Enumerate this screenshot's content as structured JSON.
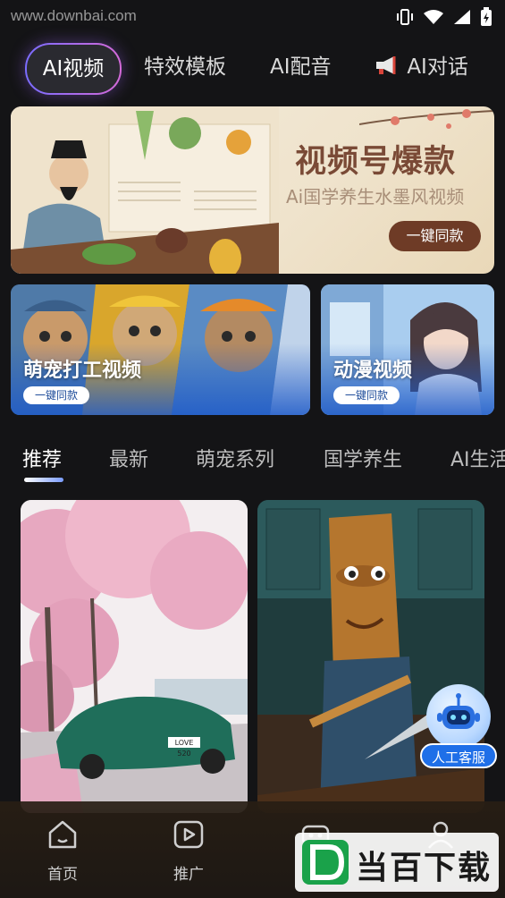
{
  "status_bar": {
    "watermark": "www.downbai.com"
  },
  "top_tabs": [
    {
      "label": "AI视频",
      "active": true
    },
    {
      "label": "特效模板",
      "active": false
    },
    {
      "label": "AI配音",
      "active": false
    },
    {
      "label": "AI对话",
      "active": false
    }
  ],
  "banner": {
    "title": "视频号爆款",
    "subtitle": "Ai国学养生水墨风视频",
    "button": "一键同款"
  },
  "cards": [
    {
      "label": "萌宠打工视频",
      "button": "一键同款"
    },
    {
      "label": "动漫视频",
      "button": "一键同款"
    }
  ],
  "category_tabs": [
    {
      "label": "推荐",
      "active": true
    },
    {
      "label": "最新",
      "active": false
    },
    {
      "label": "萌宠系列",
      "active": false
    },
    {
      "label": "国学养生",
      "active": false
    },
    {
      "label": "AI生活",
      "active": false
    }
  ],
  "feed": {
    "left_plate": "LOVE 520"
  },
  "customer_service": {
    "label": "人工客服"
  },
  "bottom_nav": [
    {
      "label": "首页",
      "icon": "home-icon"
    },
    {
      "label": "推广",
      "icon": "play-icon"
    },
    {
      "label": "",
      "icon": "robot-icon"
    },
    {
      "label": "",
      "icon": "profile-icon"
    }
  ],
  "watermark_brand": {
    "text": "当百下载"
  },
  "colors": {
    "accent_gradient_start": "#7a6cff",
    "accent_gradient_end": "#d46ad8",
    "banner_button": "#6e3b26",
    "cs_button": "#1f6fe8"
  }
}
